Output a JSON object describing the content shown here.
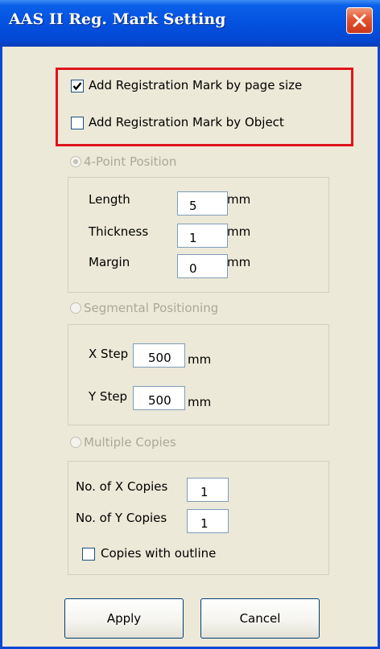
{
  "window": {
    "title": "AAS II Reg. Mark Setting"
  },
  "options": {
    "by_page_size": {
      "label": "Add Registration Mark by page size",
      "checked": true
    },
    "by_object": {
      "label": "Add Registration Mark by Object",
      "checked": false
    }
  },
  "four_point": {
    "label": "4-Point Position",
    "length": {
      "label": "Length",
      "value": "5",
      "unit": "mm"
    },
    "thickness": {
      "label": "Thickness",
      "value": "1",
      "unit": "mm"
    },
    "margin": {
      "label": "Margin",
      "value": "0",
      "unit": "mm"
    }
  },
  "segmental": {
    "label": "Segmental Positioning",
    "x_step": {
      "label": "X Step",
      "value": "500",
      "unit": "mm"
    },
    "y_step": {
      "label": "Y Step",
      "value": "500",
      "unit": "mm"
    }
  },
  "multiple": {
    "label": "Multiple Copies",
    "x_copies": {
      "label": "No. of X Copies",
      "value": "1"
    },
    "y_copies": {
      "label": "No. of Y Copies",
      "value": "1"
    },
    "outline": {
      "label": "Copies with outline",
      "checked": false
    }
  },
  "buttons": {
    "apply": "Apply",
    "cancel": "Cancel"
  }
}
